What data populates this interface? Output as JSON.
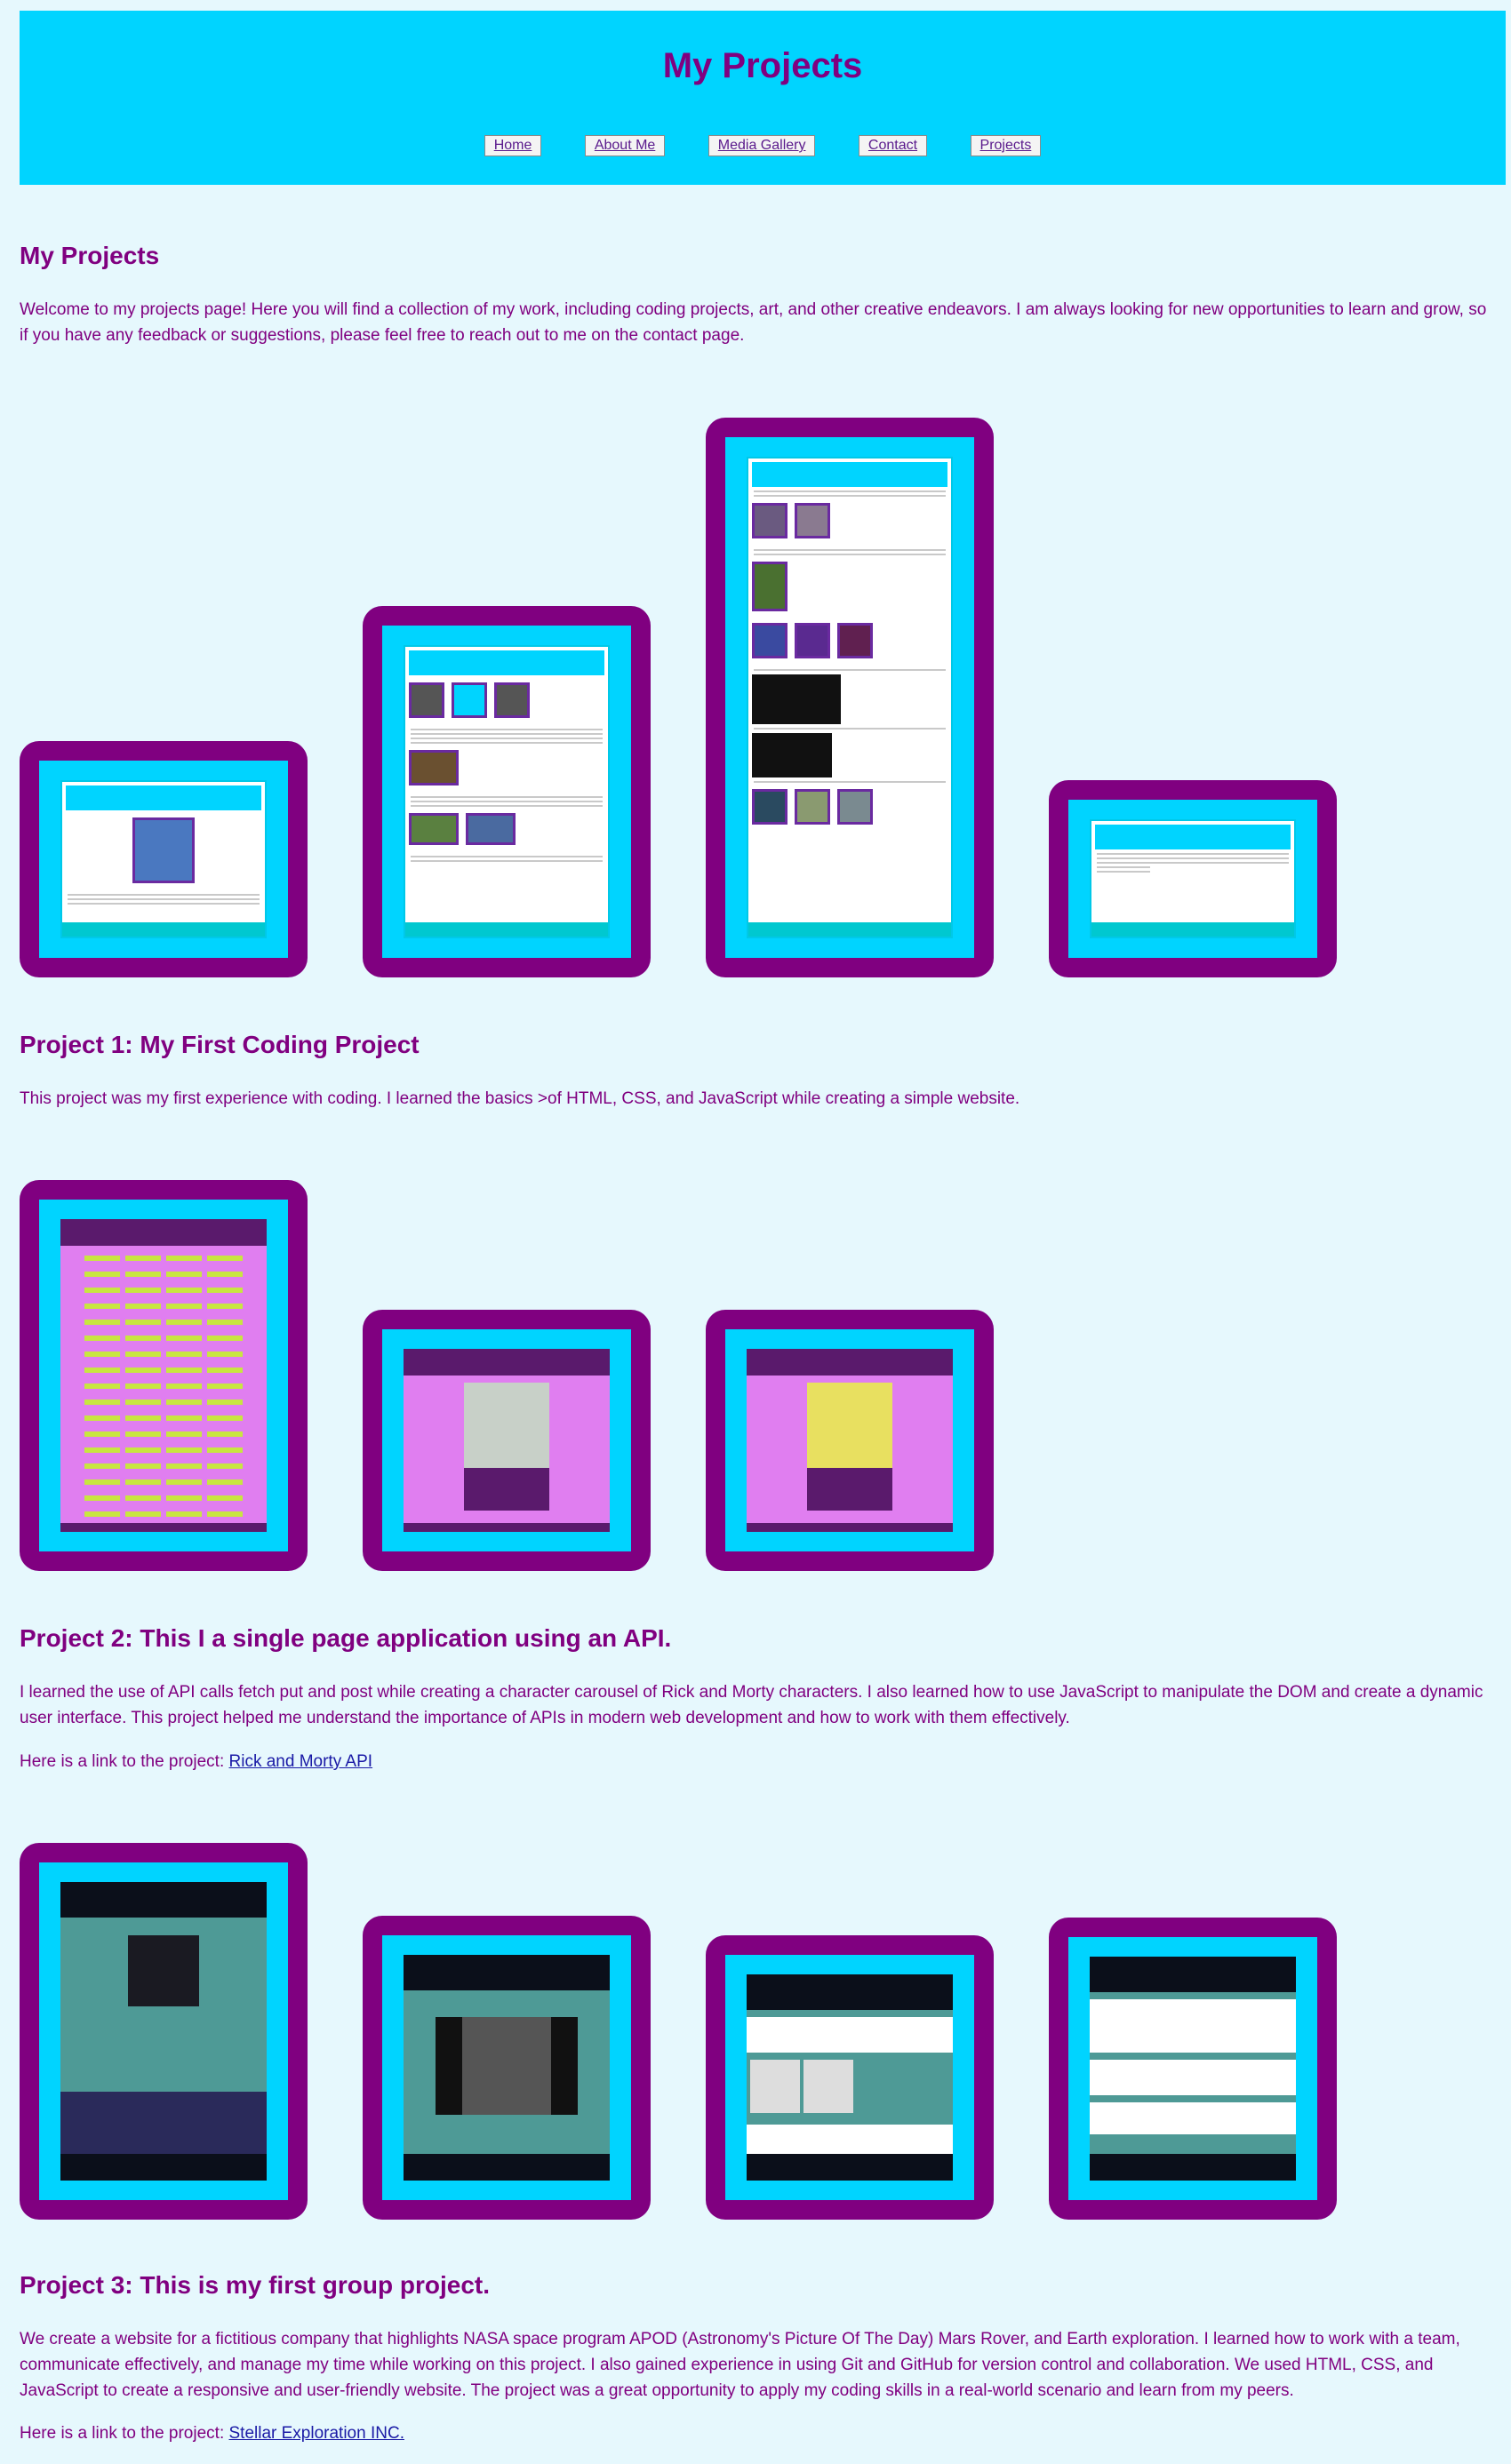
{
  "header": {
    "title": "My Projects",
    "nav": [
      "Home",
      "About Me",
      "Media Gallery",
      "Contact",
      "Projects"
    ]
  },
  "intro": {
    "heading": "My Projects",
    "text": "Welcome to my projects page! Here you will find a collection of my work, including coding projects, art, and other creative endeavors. I am always looking for new opportunities to learn and grow, so if you have any feedback or suggestions, please feel free to reach out to me on the contact page."
  },
  "project1": {
    "heading": "Project 1: My First Coding Project",
    "text": "This project was my first experience with coding. I learned the basics >of HTML, CSS, and JavaScript while creating a simple website."
  },
  "project2": {
    "heading": "Project 2: This I a single page application using an API.",
    "text": "I learned the use of API calls fetch put and post while creating a character carousel of Rick and Morty characters. I also learned how to use JavaScript to manipulate the DOM and create a dynamic user interface. This project helped me understand the importance of APIs in modern web development and how to work with them effectively.",
    "link_prefix": "Here is a link to the project:",
    "link_text": "Rick and Morty API"
  },
  "project3": {
    "heading": "Project 3: This is my first group project.",
    "text": "We create a website for a fictitious company that highlights NASA space program APOD (Astronomy's Picture Of The Day) Mars Rover, and Earth exploration. I learned how to work with a team, communicate effectively, and manage my time while working on this project. I also gained experience in using Git and GitHub for version control and collaboration. We used HTML, CSS, and JavaScript to create a responsive and user-friendly website. The project was a great opportunity to apply my coding skills in a real-world scenario and learn from my peers.",
    "link_prefix": "Here is a link to the project:",
    "link_text": "Stellar Exploration INC."
  }
}
